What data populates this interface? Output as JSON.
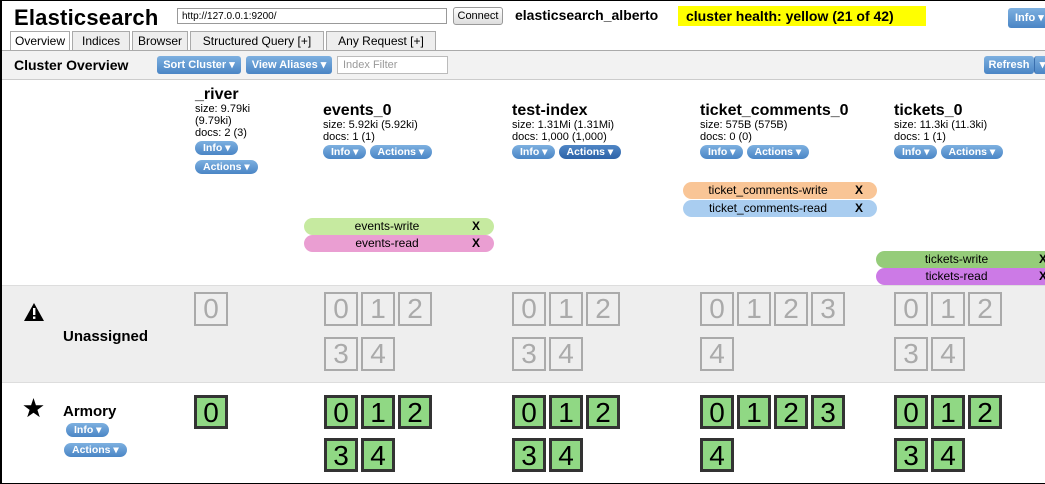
{
  "header": {
    "app_title": "Elasticsearch",
    "url_value": "http://127.0.0.1:9200/",
    "connect_label": "Connect",
    "cluster_name": "elasticsearch_alberto",
    "cluster_health": "cluster health: yellow (21 of 42)",
    "health_color": "#ffff00",
    "info_label": "Info ▾"
  },
  "tabs": [
    {
      "label": "Overview",
      "active": true
    },
    {
      "label": "Indices"
    },
    {
      "label": "Browser"
    },
    {
      "label": "Structured Query [+]"
    },
    {
      "label": "Any Request [+]"
    }
  ],
  "toolbar": {
    "title": "Cluster Overview",
    "sort_cluster": "Sort Cluster ▾",
    "view_aliases": "View Aliases ▾",
    "index_filter_placeholder": "Index Filter",
    "refresh": "Refresh",
    "refresh_menu": "▾"
  },
  "indices": [
    {
      "name": "_river",
      "size": "size: 9.79ki",
      "size2": "(9.79ki)",
      "docs": "docs: 2 (3)",
      "info": "Info ▾",
      "actions": "Actions ▾"
    },
    {
      "name": "events_0",
      "size": "size: 5.92ki (5.92ki)",
      "docs": "docs: 1 (1)",
      "info": "Info ▾",
      "actions": "Actions ▾"
    },
    {
      "name": "test-index",
      "size": "size: 1.31Mi (1.31Mi)",
      "docs": "docs: 1,000 (1,000)",
      "info": "Info ▾",
      "actions": "Actions ▾"
    },
    {
      "name": "ticket_comments_0",
      "size": "size: 575B (575B)",
      "docs": "docs: 0 (0)",
      "info": "Info ▾",
      "actions": "Actions ▾"
    },
    {
      "name": "tickets_0",
      "size": "size: 11.3ki (11.3ki)",
      "docs": "docs: 1 (1)",
      "info": "Info ▾",
      "actions": "Actions ▾"
    }
  ],
  "aliases": {
    "events_write": "events-write",
    "events_read": "events-read",
    "ticket_comments_write": "ticket_comments-write",
    "ticket_comments_read": "ticket_comments-read",
    "tickets_write": "tickets-write",
    "tickets_read": "tickets-read",
    "remove": "X",
    "colors": {
      "write_light": "#c6eaa0",
      "read_pink": "#ea9ed2",
      "write_orange": "#f9c596",
      "read_blue": "#a9cdf0",
      "write_green": "#95cc7a",
      "read_purple": "#cc7ae6"
    }
  },
  "rows": {
    "unassigned_label": "Unassigned",
    "node_label": "Armory",
    "node_info": "Info ▾",
    "node_actions": "Actions ▾"
  },
  "shards": {
    "river": [
      "0"
    ],
    "events": [
      "0",
      "1",
      "2",
      "3",
      "4"
    ],
    "test": [
      "0",
      "1",
      "2",
      "3",
      "4"
    ],
    "comments": [
      "0",
      "1",
      "2",
      "3",
      "4"
    ],
    "tickets": [
      "0",
      "1",
      "2",
      "3",
      "4"
    ]
  }
}
